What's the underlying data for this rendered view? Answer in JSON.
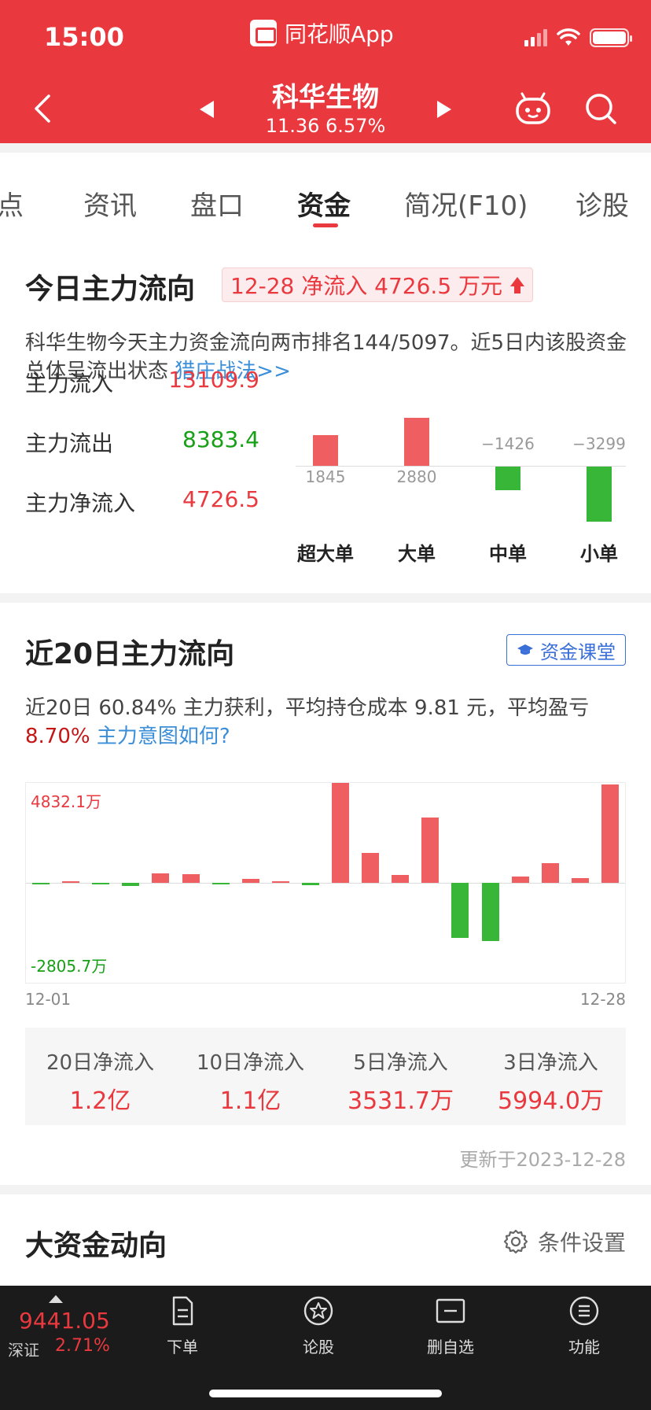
{
  "status_bar": {
    "time": "15:00",
    "app_name": "同花顺App"
  },
  "header": {
    "stock_name": "科华生物",
    "price_change": "11.36 6.57%"
  },
  "tabs": [
    {
      "label": "特点"
    },
    {
      "label": "资讯"
    },
    {
      "label": "盘口"
    },
    {
      "label": "资金"
    },
    {
      "label": "简况(F10)"
    },
    {
      "label": "诊股"
    }
  ],
  "main_flow": {
    "title": "今日主力流向",
    "badge": "12-28 净流入 4726.5 万元",
    "desc": "科华生物今天主力资金流向两市排名144/5097。近5日内该股资金总体呈流出状态",
    "desc_link": "猎庄战法>>",
    "metrics": [
      {
        "label": "主力流入",
        "value": "13109.9",
        "color": "#e9393f"
      },
      {
        "label": "主力流出",
        "value": "8383.4",
        "color": "#16a016"
      },
      {
        "label": "主力净流入",
        "value": "4726.5",
        "color": "#e9393f"
      }
    ],
    "chart_data": {
      "type": "bar",
      "categories": [
        "超大单",
        "大单",
        "中单",
        "小单"
      ],
      "values": [
        1845,
        2880,
        -1426,
        -3299
      ],
      "value_labels": [
        "1845",
        "2880",
        "−1426",
        "−3299"
      ]
    }
  },
  "flow20": {
    "title": "近20日主力流向",
    "course_button": "资金课堂",
    "desc_pre": "近20日 60.84% 主力获利，平均持仓成本 9.81 元，平均盈亏",
    "desc_pct": "8.70%",
    "desc_link": "主力意图如何?",
    "max_label": "4832.1万",
    "min_label": "-2805.7万",
    "date_start": "12-01",
    "date_end": "12-28",
    "chart_data": {
      "type": "bar",
      "values": [
        -40,
        90,
        -90,
        -140,
        460,
        400,
        -30,
        180,
        60,
        -120,
        4832.1,
        1450,
        380,
        3150,
        -2650,
        -2805.7,
        310,
        960,
        230,
        4740
      ],
      "ylim": [
        -2805.7,
        4832.1
      ],
      "colors": {
        "positive": "#ef5f62",
        "negative": "#38b638"
      }
    },
    "summary": [
      {
        "label": "20日净流入",
        "value": "1.2亿"
      },
      {
        "label": "10日净流入",
        "value": "1.1亿"
      },
      {
        "label": "5日净流入",
        "value": "3531.7万"
      },
      {
        "label": "3日净流入",
        "value": "5994.0万"
      }
    ],
    "updated": "更新于2023-12-28"
  },
  "big_funds": {
    "title": "大资金动向",
    "settings": "条件设置"
  },
  "bottom_bar": {
    "index_value": "9441.05",
    "index_name": "深证",
    "index_change": "2.71%",
    "nav": [
      {
        "label": "下单",
        "icon": "order-icon"
      },
      {
        "label": "论股",
        "icon": "discuss-icon"
      },
      {
        "label": "删自选",
        "icon": "remove-favorite-icon"
      },
      {
        "label": "功能",
        "icon": "menu-icon"
      }
    ]
  }
}
